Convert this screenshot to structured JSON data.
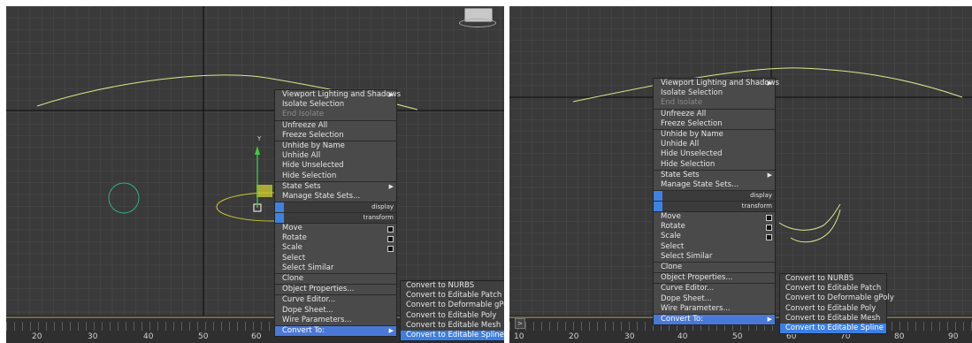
{
  "left": {
    "ruler_labels": [
      "20",
      "30",
      "40",
      "50",
      "60"
    ],
    "gizmo_label": "Y",
    "quad_labels": {
      "display": "display",
      "transform": "transform"
    },
    "menu_items": [
      {
        "label": "Viewport Lighting and Shadows",
        "arrow": true
      },
      {
        "label": "Isolate Selection"
      },
      {
        "label": "End Isolate",
        "disabled": true
      },
      {
        "label": "Unfreeze All",
        "sep": true
      },
      {
        "label": "Freeze Selection"
      },
      {
        "label": "Unhide by Name",
        "sep": true
      },
      {
        "label": "Unhide All"
      },
      {
        "label": "Hide Unselected"
      },
      {
        "label": "Hide Selection"
      },
      {
        "label": "State Sets",
        "arrow": true,
        "sep": true
      },
      {
        "label": "Manage State Sets..."
      },
      {
        "quad": "display"
      },
      {
        "quad": "transform"
      },
      {
        "label": "Move",
        "opt": true,
        "sep": true
      },
      {
        "label": "Rotate",
        "opt": true
      },
      {
        "label": "Scale",
        "opt": true
      },
      {
        "label": "Select"
      },
      {
        "label": "Select Similar"
      },
      {
        "label": "Clone",
        "sep": true
      },
      {
        "label": "Object Properties...",
        "sep": true
      },
      {
        "label": "Curve Editor...",
        "sep": true
      },
      {
        "label": "Dope Sheet..."
      },
      {
        "label": "Wire Parameters..."
      },
      {
        "label": "Convert To:",
        "arrow": true,
        "sep": true,
        "highlighted": true
      }
    ],
    "submenu_items": [
      {
        "label": "Convert to NURBS"
      },
      {
        "label": "Convert to Editable Patch"
      },
      {
        "label": "Convert to Deformable gPoly"
      },
      {
        "label": "Convert to Editable Poly"
      },
      {
        "label": "Convert to Editable Mesh"
      },
      {
        "label": "Convert to Editable Spline",
        "highlighted": true
      }
    ]
  },
  "right": {
    "ruler_labels": [
      "10",
      "20",
      "30",
      "40",
      "50",
      "60",
      "70",
      "80",
      "90"
    ],
    "corner_button": ">",
    "quad_labels": {
      "display": "display",
      "transform": "transform"
    },
    "menu_items": [
      {
        "label": "Viewport Lighting and Shadows",
        "arrow": true
      },
      {
        "label": "Isolate Selection"
      },
      {
        "label": "End Isolate",
        "disabled": true
      },
      {
        "label": "Unfreeze All",
        "sep": true
      },
      {
        "label": "Freeze Selection"
      },
      {
        "label": "Unhide by Name",
        "sep": true
      },
      {
        "label": "Unhide All"
      },
      {
        "label": "Hide Unselected"
      },
      {
        "label": "Hide Selection"
      },
      {
        "label": "State Sets",
        "arrow": true,
        "sep": true
      },
      {
        "label": "Manage State Sets..."
      },
      {
        "quad": "display"
      },
      {
        "quad": "transform"
      },
      {
        "label": "Move",
        "opt": true,
        "sep": true
      },
      {
        "label": "Rotate",
        "opt": true
      },
      {
        "label": "Scale",
        "opt": true
      },
      {
        "label": "Select"
      },
      {
        "label": "Select Similar"
      },
      {
        "label": "Clone",
        "sep": true
      },
      {
        "label": "Object Properties...",
        "sep": true
      },
      {
        "label": "Curve Editor...",
        "sep": true
      },
      {
        "label": "Dope Sheet..."
      },
      {
        "label": "Wire Parameters..."
      },
      {
        "label": "Convert To:",
        "arrow": true,
        "sep": true,
        "highlighted": true
      }
    ],
    "submenu_items": [
      {
        "label": "Convert to NURBS"
      },
      {
        "label": "Convert to Editable Patch"
      },
      {
        "label": "Convert to Deformable gPoly"
      },
      {
        "label": "Convert to Editable Poly"
      },
      {
        "label": "Convert to Editable Mesh"
      },
      {
        "label": "Convert to Editable Spline",
        "highlighted": true
      }
    ]
  },
  "colors": {
    "viewport_bg": "#3a3a3a",
    "spline": "#d8e88a",
    "circle": "#2bb38a",
    "ellipse": "#c8c832",
    "highlight": "#3d7fe0"
  }
}
